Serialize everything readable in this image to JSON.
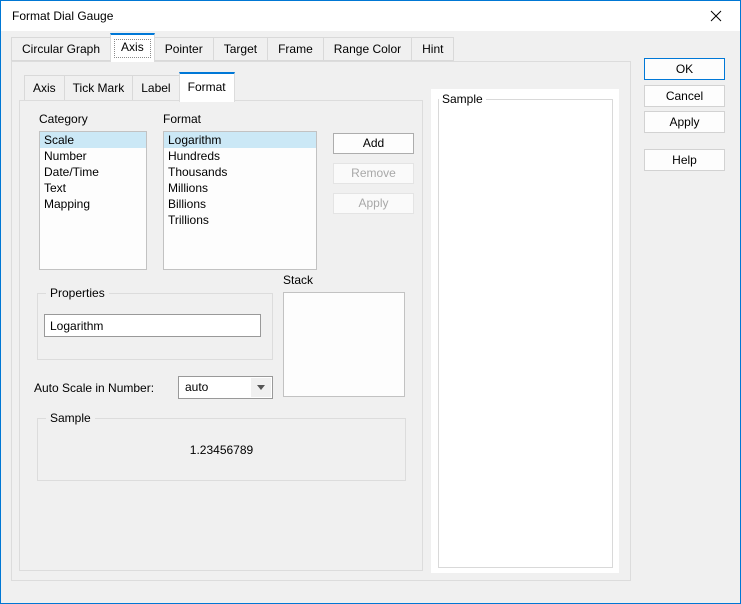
{
  "window": {
    "title": "Format Dial Gauge"
  },
  "main_tabs": {
    "selected": "Axis",
    "items": [
      "Circular Graph",
      "Axis",
      "Pointer",
      "Target",
      "Frame",
      "Range Color",
      "Hint"
    ]
  },
  "sub_tabs": {
    "selected": "Format",
    "items": [
      "Axis",
      "Tick Mark",
      "Label",
      "Format"
    ]
  },
  "format_panel": {
    "category": {
      "label": "Category",
      "selected": "Scale",
      "items": [
        "Scale",
        "Number",
        "Date/Time",
        "Text",
        "Mapping"
      ]
    },
    "format": {
      "label": "Format",
      "selected": "Logarithm",
      "items": [
        "Logarithm",
        "Hundreds",
        "Thousands",
        "Millions",
        "Billions",
        "Trillions"
      ]
    },
    "add_label": "Add",
    "remove_label": "Remove",
    "apply_label": "Apply",
    "properties": {
      "legend": "Properties",
      "value": "Logarithm"
    },
    "stack": {
      "label": "Stack"
    },
    "auto_scale": {
      "label": "Auto Scale in Number:",
      "value": "auto"
    },
    "sample": {
      "legend": "Sample",
      "value": "1.23456789"
    }
  },
  "preview": {
    "legend": "Sample"
  },
  "actions": {
    "ok": "OK",
    "cancel": "Cancel",
    "apply": "Apply",
    "help": "Help"
  },
  "colors": {
    "accent": "#0078d7",
    "selection": "#cbe8f6",
    "dialog_bg": "#f0f0f0"
  }
}
